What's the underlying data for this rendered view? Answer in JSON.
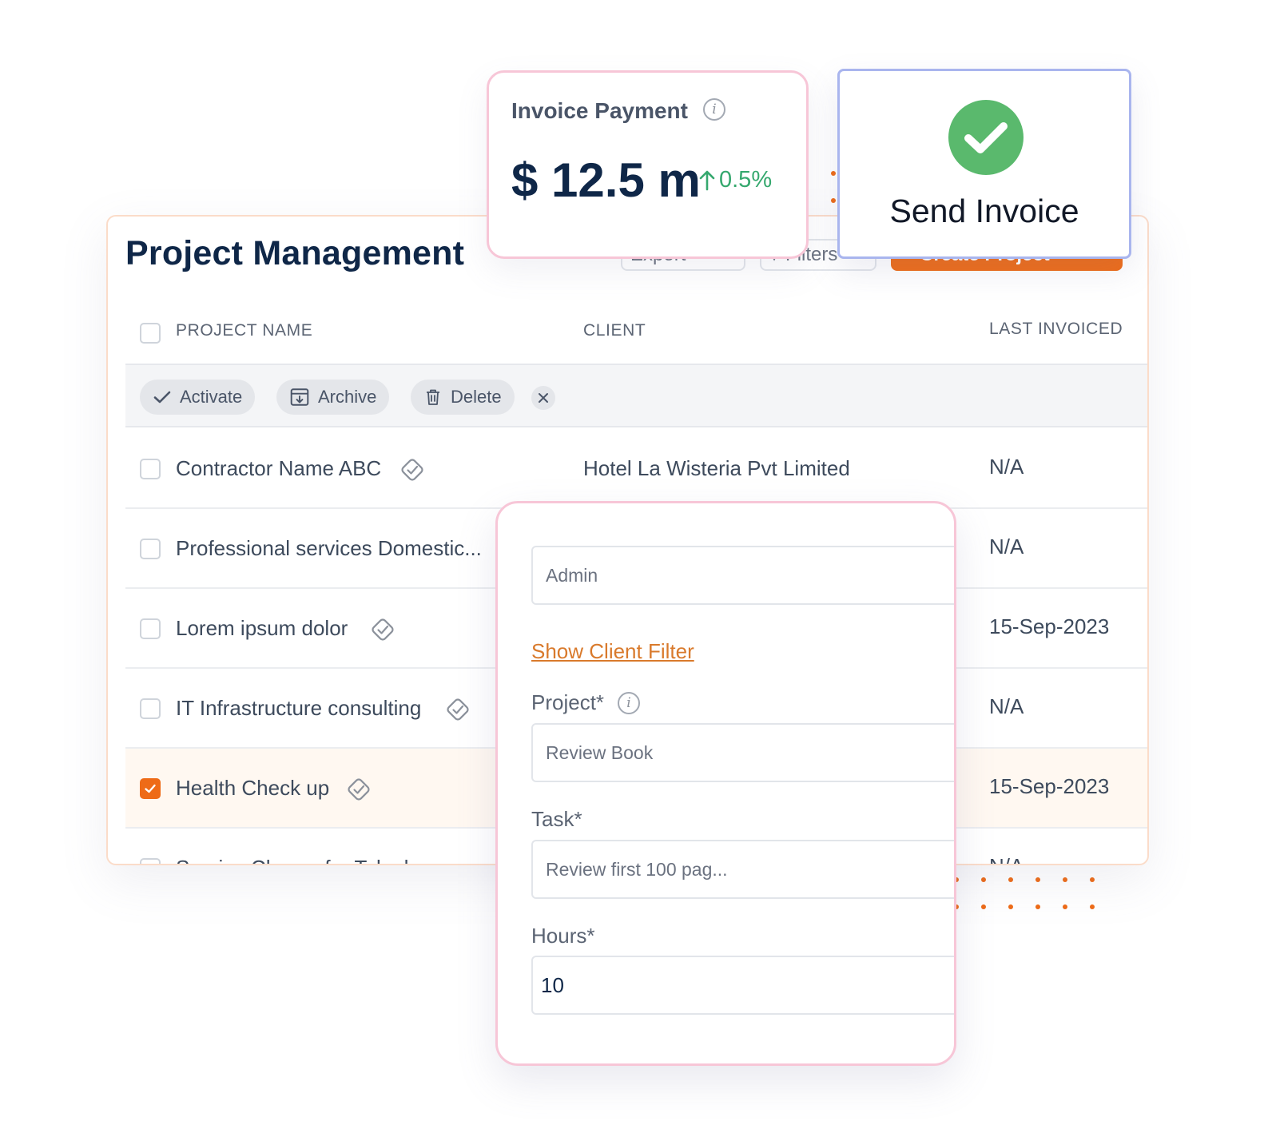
{
  "invoice_card": {
    "title": "Invoice Payment",
    "amount": "$ 12.5 m",
    "change": "0.5%"
  },
  "send_card": {
    "label": "Send Invoice"
  },
  "project_table": {
    "title": "Project Management",
    "buttons": {
      "export": "Export",
      "filters": "Filters",
      "create": "Create Project"
    },
    "columns": {
      "project_name": "PROJECT NAME",
      "client": "CLIENT",
      "last_invoiced": "LAST INVOICED"
    },
    "bulk_actions": {
      "activate": "Activate",
      "archive": "Archive",
      "delete": "Delete"
    },
    "rows": [
      {
        "name": "Contractor Name ABC",
        "client": "Hotel La Wisteria Pvt Limited",
        "last_invoiced": "N/A",
        "checked": false,
        "verified": true
      },
      {
        "name": "Professional services Domestic...",
        "client": "",
        "last_invoiced": "N/A",
        "checked": false,
        "verified": false
      },
      {
        "name": "Lorem ipsum dolor",
        "client": "",
        "last_invoiced": "15-Sep-2023",
        "checked": false,
        "verified": true
      },
      {
        "name": "IT Infrastructure consulting",
        "client": "",
        "last_invoiced": "N/A",
        "checked": false,
        "verified": true
      },
      {
        "name": "Health Check up",
        "client": "",
        "last_invoiced": "15-Sep-2023",
        "checked": true,
        "verified": true
      },
      {
        "name": "Service Charge for Telephone",
        "client": "",
        "last_invoiced": "N/A",
        "checked": false,
        "verified": false
      }
    ]
  },
  "timesheet_form": {
    "assignee_value": "Admin",
    "show_client_filter": "Show Client Filter",
    "project_label": "Project*",
    "project_value": "Review Book",
    "task_label": "Task*",
    "task_value": "Review first 100 pag...",
    "hours_label": "Hours*",
    "hours_value": "10"
  },
  "colors": {
    "accent": "#ee6b17",
    "title_navy": "#0f2748",
    "success_green": "#5ab96d",
    "positive_change": "#35a86e",
    "card_border_pink": "#f7c6d7",
    "card_border_blue": "#a9b5ee"
  }
}
